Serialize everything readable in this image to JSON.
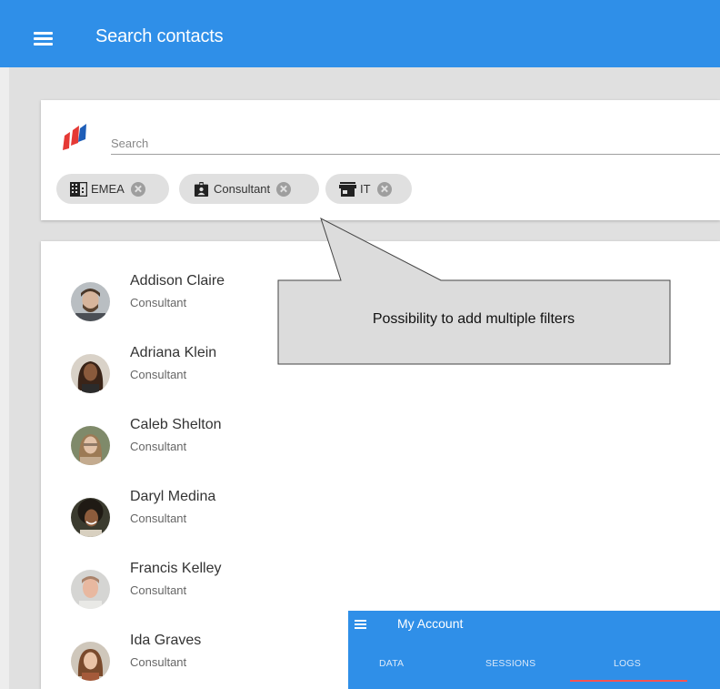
{
  "app_bar": {
    "title": "Search contacts",
    "menu_icon": "hamburger-menu-icon",
    "color": "#2f8fe8"
  },
  "search": {
    "placeholder": "Search",
    "value": "",
    "logo_icon": "brand-logo-icon",
    "filters": [
      {
        "label": "EMEA",
        "icon": "building-icon"
      },
      {
        "label": "Consultant",
        "icon": "badge-icon"
      },
      {
        "label": "IT",
        "icon": "store-icon"
      }
    ]
  },
  "contacts": [
    {
      "name": "Addison Claire",
      "role": "Consultant"
    },
    {
      "name": "Adriana Klein",
      "role": "Consultant"
    },
    {
      "name": "Caleb Shelton",
      "role": "Consultant"
    },
    {
      "name": "Daryl Medina",
      "role": "Consultant"
    },
    {
      "name": "Francis Kelley",
      "role": "Consultant"
    },
    {
      "name": "Ida Graves",
      "role": "Consultant"
    }
  ],
  "callout": {
    "text": "Possibility to add multiple filters"
  },
  "mini_preview": {
    "title": "My Account",
    "tabs": [
      "DATA",
      "SESSIONS",
      "LOGS"
    ],
    "active_tab": "LOGS",
    "indicator_color": "#ff5252"
  }
}
